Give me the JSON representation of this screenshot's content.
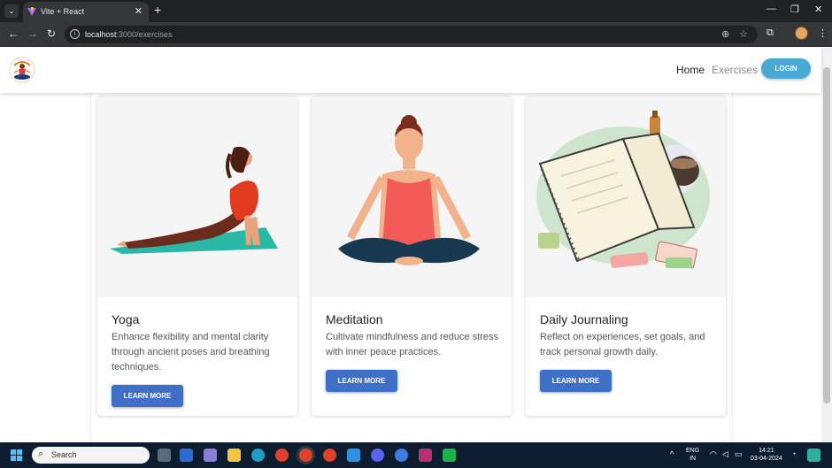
{
  "browser": {
    "tab_title": "Vite + React",
    "tab_close": "✕",
    "new_tab": "+",
    "url_host": "localhost",
    "url_path": ":3000/exercises"
  },
  "navbar": {
    "home_label": "Home",
    "exercises_label": "Exercises",
    "login_label": "LOGIN"
  },
  "cards": [
    {
      "title": "Yoga",
      "description": "Enhance flexibility and mental clarity through ancient poses and breathing techniques.",
      "button_label": "LEARN MORE"
    },
    {
      "title": "Meditation",
      "description": "Cultivate mindfulness and reduce stress with inner peace practices.",
      "button_label": "LEARN MORE"
    },
    {
      "title": "Daily Journaling",
      "description": "Reflect on experiences, set goals, and track personal growth daily.",
      "button_label": "LEARN MORE"
    }
  ],
  "taskbar": {
    "search_label": "Search",
    "lang_top": "ENG",
    "lang_bottom": "IN",
    "time": "14:21",
    "date": "03-04-2024"
  },
  "colors": {
    "login_button": "#4aa9d4",
    "learn_more_button": "#3f6fc7"
  }
}
